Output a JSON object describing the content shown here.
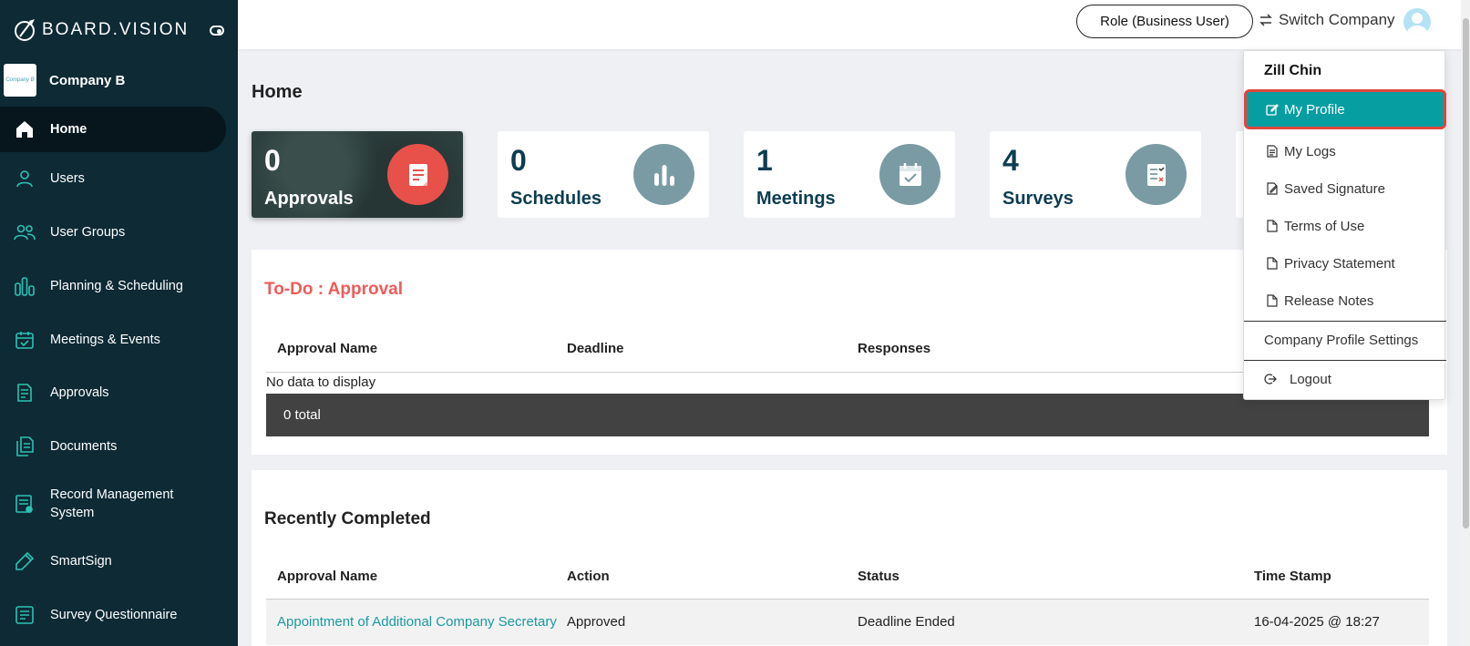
{
  "brand": {
    "name": "BOARD.VISION"
  },
  "company": {
    "logo_text": "Company B",
    "name": "Company B"
  },
  "nav": {
    "items": [
      {
        "label": "Home",
        "icon": "home-icon"
      },
      {
        "label": "Users",
        "icon": "user-icon"
      },
      {
        "label": "User Groups",
        "icon": "user-groups-icon"
      },
      {
        "label": "Planning & Scheduling",
        "icon": "bar-chart-icon"
      },
      {
        "label": "Meetings & Events",
        "icon": "calendar-check-icon"
      },
      {
        "label": "Approvals",
        "icon": "document-icon"
      },
      {
        "label": "Documents",
        "icon": "documents-icon"
      },
      {
        "label": "Record Management System",
        "icon": "record-icon"
      },
      {
        "label": "SmartSign",
        "icon": "pen-icon"
      },
      {
        "label": "Survey Questionnaire",
        "icon": "survey-icon"
      }
    ]
  },
  "topbar": {
    "role_label": "Role (Business User)",
    "switch_company_label": "Switch Company"
  },
  "page": {
    "title": "Home"
  },
  "stats": [
    {
      "count": "0",
      "label": "Approvals",
      "icon": "approval-doc-icon"
    },
    {
      "count": "0",
      "label": "Schedules",
      "icon": "bar-chart-icon"
    },
    {
      "count": "1",
      "label": "Meetings",
      "icon": "calendar-icon"
    },
    {
      "count": "4",
      "label": "Surveys",
      "icon": "survey-checklist-icon"
    }
  ],
  "todo": {
    "title": "To-Do : Approval",
    "columns": [
      "Approval Name",
      "Deadline",
      "Responses"
    ],
    "empty_text": "No data to display",
    "total_text": "0 total"
  },
  "recent": {
    "title": "Recently Completed",
    "columns": [
      "Approval Name",
      "Action",
      "Status",
      "Time Stamp"
    ],
    "rows": [
      {
        "name": "Appointment of Additional Company Secretary",
        "action": "Approved",
        "status": "Deadline Ended",
        "timestamp": "16-04-2025 @ 18:27"
      }
    ]
  },
  "user_menu": {
    "user_name": "Zill Chin",
    "items": [
      {
        "label": "My Profile",
        "icon": "edit-icon"
      },
      {
        "label": "My Logs",
        "icon": "log-icon"
      },
      {
        "label": "Saved Signature",
        "icon": "signature-edit-icon"
      },
      {
        "label": "Terms of Use",
        "icon": "file-icon"
      },
      {
        "label": "Privacy Statement",
        "icon": "file-icon"
      },
      {
        "label": "Release Notes",
        "icon": "file-icon"
      },
      {
        "label": "Company Profile Settings",
        "icon": ""
      },
      {
        "label": "Logout",
        "icon": "logout-icon"
      }
    ]
  },
  "colors": {
    "sidebar_bg": "#0d2a35",
    "accent_teal": "#079ea2",
    "highlight_red": "#e0463c",
    "todo_title": "#ef5b5b",
    "stat_text": "#0d3d52"
  }
}
